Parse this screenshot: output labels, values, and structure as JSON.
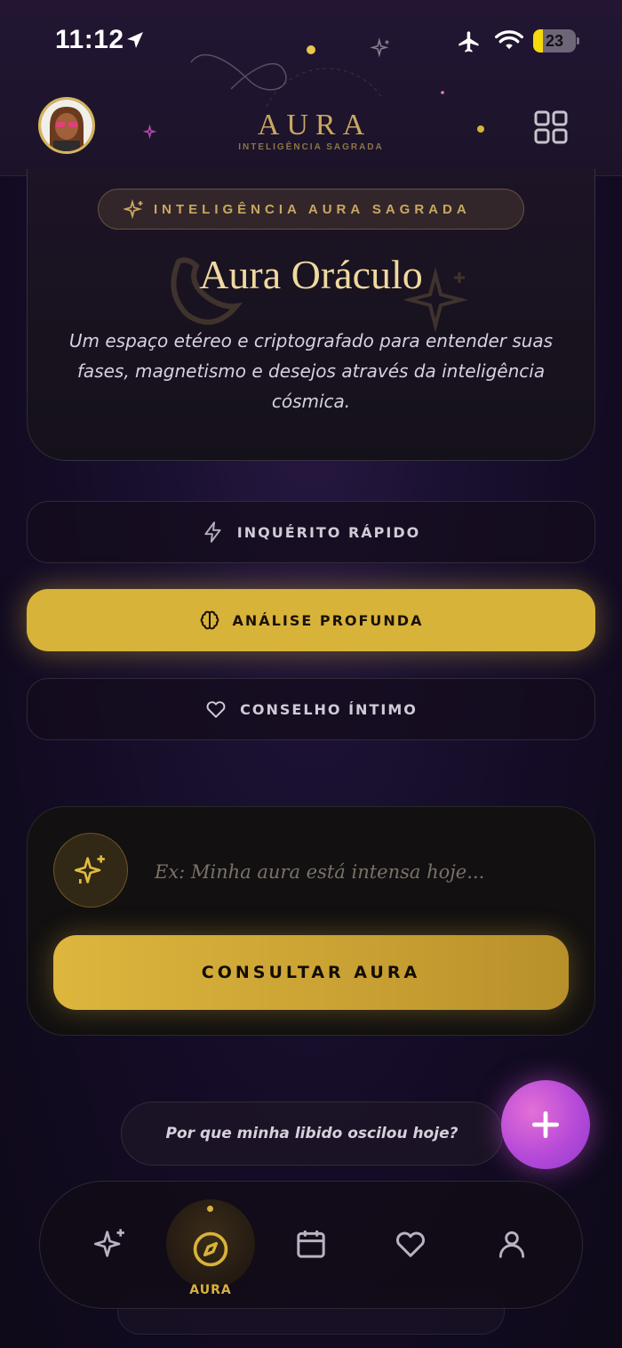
{
  "status_bar": {
    "time": "11:12",
    "battery": "23",
    "battery_level": 0.23,
    "icons": [
      "location-arrow-icon",
      "airplane-icon",
      "wifi-icon",
      "battery-icon"
    ]
  },
  "header": {
    "brand": "AURA",
    "brand_subtitle": "INTELIGÊNCIA SAGRADA",
    "menu_icon": "grid-icon"
  },
  "hero": {
    "badge": "INTELIGÊNCIA AURA SAGRADA",
    "title": "Aura Oráculo",
    "description": "Um espaço etéreo e criptografado para entender suas fases, magnetismo e desejos através da inteligência cósmica."
  },
  "modes": [
    {
      "label": "INQUÉRITO RÁPIDO",
      "icon": "lightning-icon",
      "active": false
    },
    {
      "label": "ANÁLISE PROFUNDA",
      "icon": "brain-icon",
      "active": true
    },
    {
      "label": "CONSELHO ÍNTIMO",
      "icon": "heart-icon",
      "active": false
    }
  ],
  "query": {
    "placeholder": "Ex: Minha aura está intensa hoje...",
    "value": "",
    "button": "CONSULTAR AURA"
  },
  "suggestion": "Por que minha libido oscilou hoje?",
  "nav": {
    "items": [
      {
        "icon": "sparkles-icon"
      },
      {
        "icon": "compass-icon",
        "label": "AURA",
        "active": true
      },
      {
        "icon": "calendar-icon"
      },
      {
        "icon": "heart-icon"
      },
      {
        "icon": "profile-icon"
      }
    ]
  },
  "colors": {
    "gold": "#d8b33a",
    "brand_gold": "#c9a860",
    "fab_pink": "#c44fd8",
    "background": "#1a1030"
  }
}
